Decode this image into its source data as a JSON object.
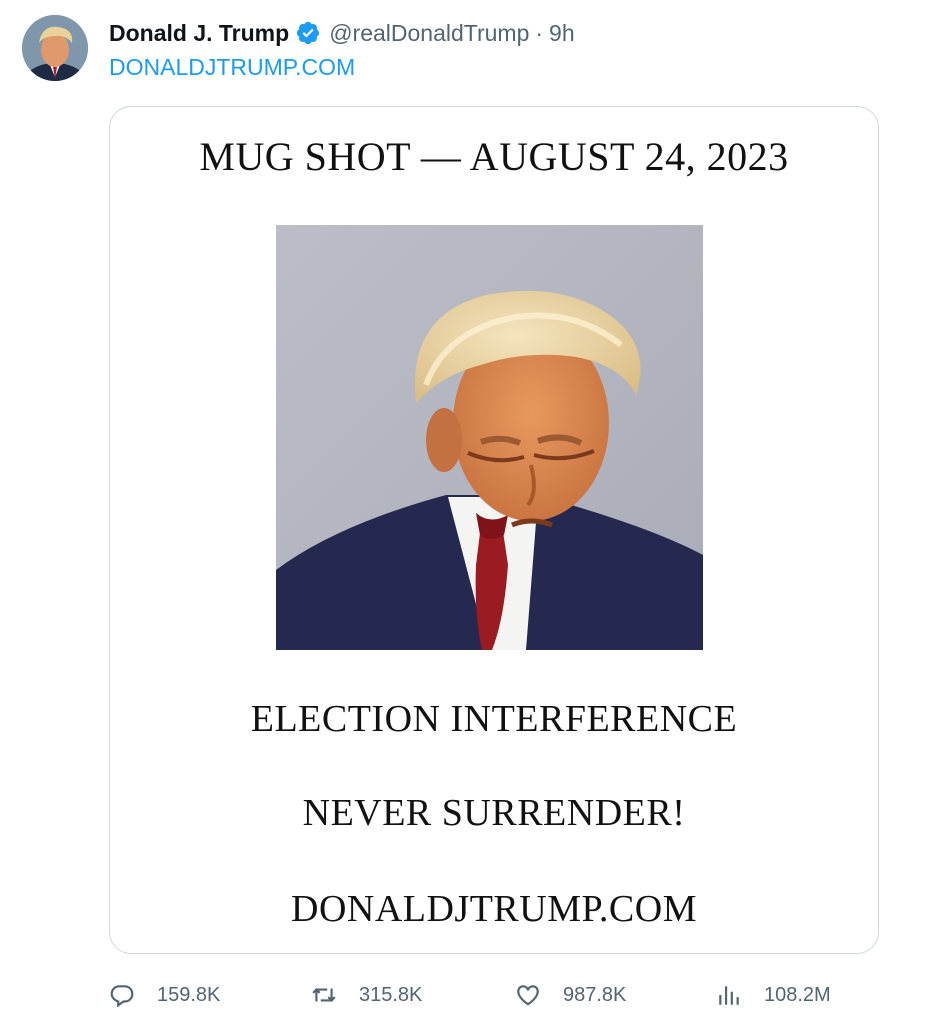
{
  "author": {
    "display_name": "Donald J. Trump",
    "handle": "@realDonaldTrump",
    "separator": "·",
    "time": "9h",
    "verified": true,
    "avatar_icon": "profile-photo"
  },
  "tweet": {
    "link_text": "DONALDJTRUMP.COM",
    "link_color": "#1d9bf0"
  },
  "media": {
    "title": "MUG SHOT — AUGUST 24, 2023",
    "line1": "ELECTION INTERFERENCE",
    "line2": "NEVER SURRENDER!",
    "line3": "DONALDJTRUMP.COM"
  },
  "actions": {
    "replies": {
      "icon": "reply-icon",
      "count": "159.8K"
    },
    "retweets": {
      "icon": "retweet-icon",
      "count": "315.8K"
    },
    "likes": {
      "icon": "heart-icon",
      "count": "987.8K"
    },
    "views": {
      "icon": "views-icon",
      "count": "108.2M"
    }
  }
}
